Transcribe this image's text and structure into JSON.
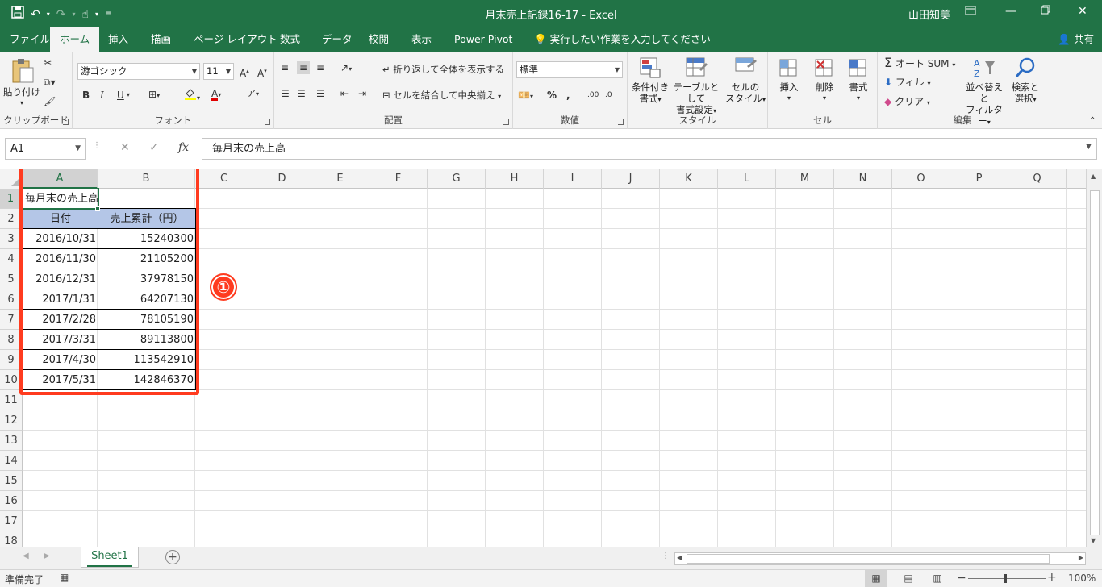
{
  "window": {
    "title": "月末売上記録16-17  -  Excel",
    "user": "山田知美",
    "share_label": "共有",
    "accent": "#217346"
  },
  "tabs": [
    {
      "label": "ファイル"
    },
    {
      "label": "ホーム"
    },
    {
      "label": "挿入"
    },
    {
      "label": "描画"
    },
    {
      "label": "ページ レイアウト"
    },
    {
      "label": "数式"
    },
    {
      "label": "データ"
    },
    {
      "label": "校閲"
    },
    {
      "label": "表示"
    },
    {
      "label": "Power Pivot"
    },
    {
      "label": "実行したい作業を入力してください"
    }
  ],
  "ribbon": {
    "clipboard": {
      "label": "クリップボード",
      "paste": "貼り付け"
    },
    "font": {
      "label": "フォント",
      "name": "游ゴシック",
      "size": "11",
      "bold": "B",
      "italic": "I",
      "underline": "U"
    },
    "alignment": {
      "label": "配置",
      "wrap": "折り返して全体を表示する",
      "merge": "セルを結合して中央揃え"
    },
    "number": {
      "label": "数値",
      "format": "標準"
    },
    "styles": {
      "label": "スタイル",
      "cond_1": "条件付き",
      "cond_2": "書式",
      "table_1": "テーブルとして",
      "table_2": "書式設定",
      "cell_1": "セルの",
      "cell_2": "スタイル"
    },
    "cells": {
      "label": "セル",
      "insert": "挿入",
      "delete": "削除",
      "format": "書式"
    },
    "editing": {
      "label": "編集",
      "autosum": "オート SUM",
      "fill": "フィル",
      "clear": "クリア",
      "sort_1": "並べ替えと",
      "sort_2": "フィルター",
      "find_1": "検索と",
      "find_2": "選択"
    }
  },
  "formula_bar": {
    "name_box": "A1",
    "content": "毎月末の売上高"
  },
  "columns": [
    "A",
    "B",
    "C",
    "D",
    "E",
    "F",
    "G",
    "H",
    "I",
    "J",
    "K",
    "L",
    "M",
    "N",
    "O",
    "P",
    "Q"
  ],
  "rows": [
    "1",
    "2",
    "3",
    "4",
    "5",
    "6",
    "7",
    "8",
    "9",
    "10",
    "11",
    "12",
    "13",
    "14",
    "15",
    "16",
    "17",
    "18"
  ],
  "sheet": {
    "a1": "毎月末の売上高",
    "header_date": "日付",
    "header_sales": "売上累計（円）",
    "data": [
      {
        "date": "2016/10/31",
        "value": "15240300"
      },
      {
        "date": "2016/11/30",
        "value": "21105200"
      },
      {
        "date": "2016/12/31",
        "value": "37978150"
      },
      {
        "date": "2017/1/31",
        "value": "64207130"
      },
      {
        "date": "2017/2/28",
        "value": "78105190"
      },
      {
        "date": "2017/3/31",
        "value": "89113800"
      },
      {
        "date": "2017/4/30",
        "value": "113542910"
      },
      {
        "date": "2017/5/31",
        "value": "142846370"
      }
    ]
  },
  "annotation": {
    "label": "①",
    "color": "#ff3b1f"
  },
  "sheet_tabs": [
    {
      "label": "Sheet1"
    }
  ],
  "status": {
    "ready": "準備完了",
    "zoom": "100%"
  }
}
